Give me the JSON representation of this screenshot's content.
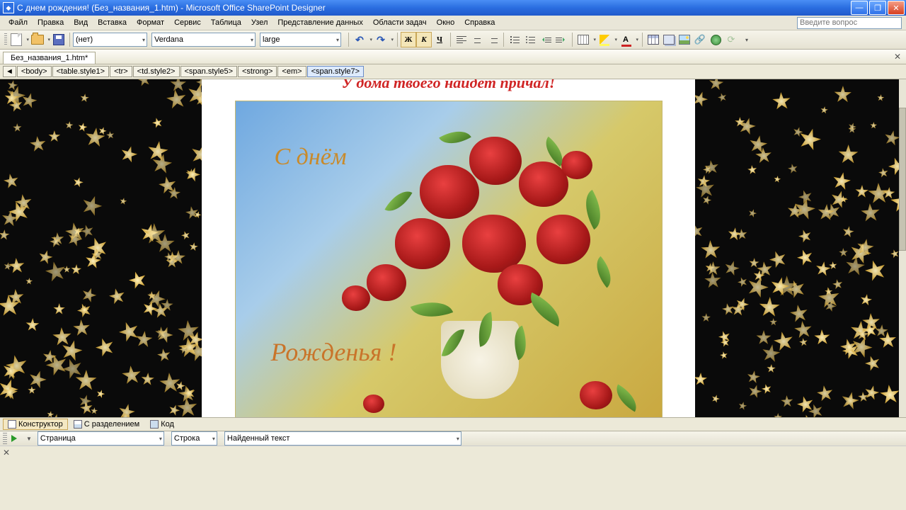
{
  "window": {
    "title": "С днем рождения! (Без_названия_1.htm) - Microsoft Office SharePoint Designer",
    "help_placeholder": "Введите вопрос"
  },
  "menu": {
    "file": "Файл",
    "edit": "Правка",
    "view": "Вид",
    "insert": "Вставка",
    "format": "Формат",
    "tools": "Сервис",
    "table": "Таблица",
    "node": "Узел",
    "datapres": "Представление данных",
    "taskpanes": "Области задач",
    "window": "Окно",
    "help": "Справка"
  },
  "toolbar": {
    "style": "(нет)",
    "font": "Verdana",
    "size": "large",
    "bold": "Ж",
    "italic": "К",
    "underline": "Ч",
    "fontcolor_letter": "A"
  },
  "tabs": {
    "file": "Без_названия_1.htm*"
  },
  "breadcrumb": {
    "arrow": "◄",
    "items": [
      "<body>",
      "<table.style1>",
      "<tr>",
      "<td.style2>",
      "<span.style5>",
      "<strong>",
      "<em>",
      "<span.style7>"
    ]
  },
  "content": {
    "headline": "У дома твоего найдет причал!",
    "card_line1": "С днём",
    "card_line2": "Рожденья !"
  },
  "views": {
    "designer": "Конструктор",
    "split": "С разделением",
    "code": "Код"
  },
  "search": {
    "page": "Страница",
    "line": "Строка",
    "found": "Найденный текст"
  }
}
